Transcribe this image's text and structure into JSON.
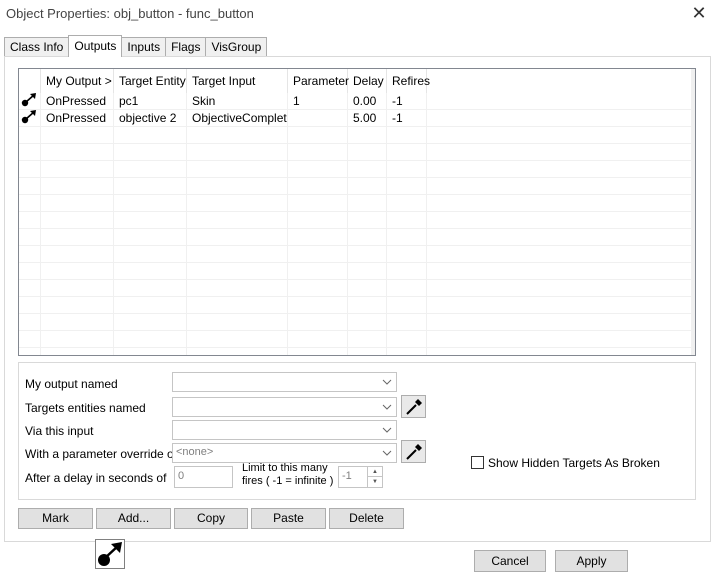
{
  "window": {
    "title": "Object Properties: obj_button - func_button",
    "close_glyph": "✕"
  },
  "tabs": [
    {
      "label": "Class Info",
      "active": false
    },
    {
      "label": "Outputs",
      "active": true
    },
    {
      "label": "Inputs",
      "active": false
    },
    {
      "label": "Flags",
      "active": false
    },
    {
      "label": "VisGroup",
      "active": false
    }
  ],
  "grid": {
    "columns": [
      "",
      "My Output  >",
      "Target Entity",
      "Target Input",
      "Parameter",
      "Delay",
      "Refires"
    ],
    "rows": [
      {
        "icon": "output-connection-icon",
        "output": "OnPressed",
        "target": "pc1",
        "input": "Skin",
        "parameter": "1",
        "delay": "0.00",
        "refires": "-1"
      },
      {
        "icon": "output-connection-icon",
        "output": "OnPressed",
        "target": "objective 2",
        "input": "ObjectiveComplete",
        "parameter": "",
        "delay": "5.00",
        "refires": "-1"
      }
    ]
  },
  "form": {
    "my_output_label": "My output named",
    "my_output_value": "",
    "targets_label": "Targets entities named",
    "targets_value": "",
    "via_input_label": "Via this input",
    "via_input_value": "",
    "param_label": "With a parameter override of",
    "param_value": "<none>",
    "delay_label": "After a delay in seconds of",
    "delay_value": "0",
    "limit_label": "Limit to this many fires ( -1 = infinite )",
    "limit_value": "-1"
  },
  "buttons": {
    "mark": "Mark",
    "add": "Add...",
    "copy": "Copy",
    "paste": "Paste",
    "delete": "Delete"
  },
  "show_hidden_label": "Show Hidden Targets As Broken",
  "show_hidden_checked": false,
  "footer": {
    "cancel": "Cancel",
    "apply": "Apply"
  },
  "colors": {
    "button_bg": "#e1e1e1",
    "border": "#adadad",
    "grid_border": "#828790"
  }
}
